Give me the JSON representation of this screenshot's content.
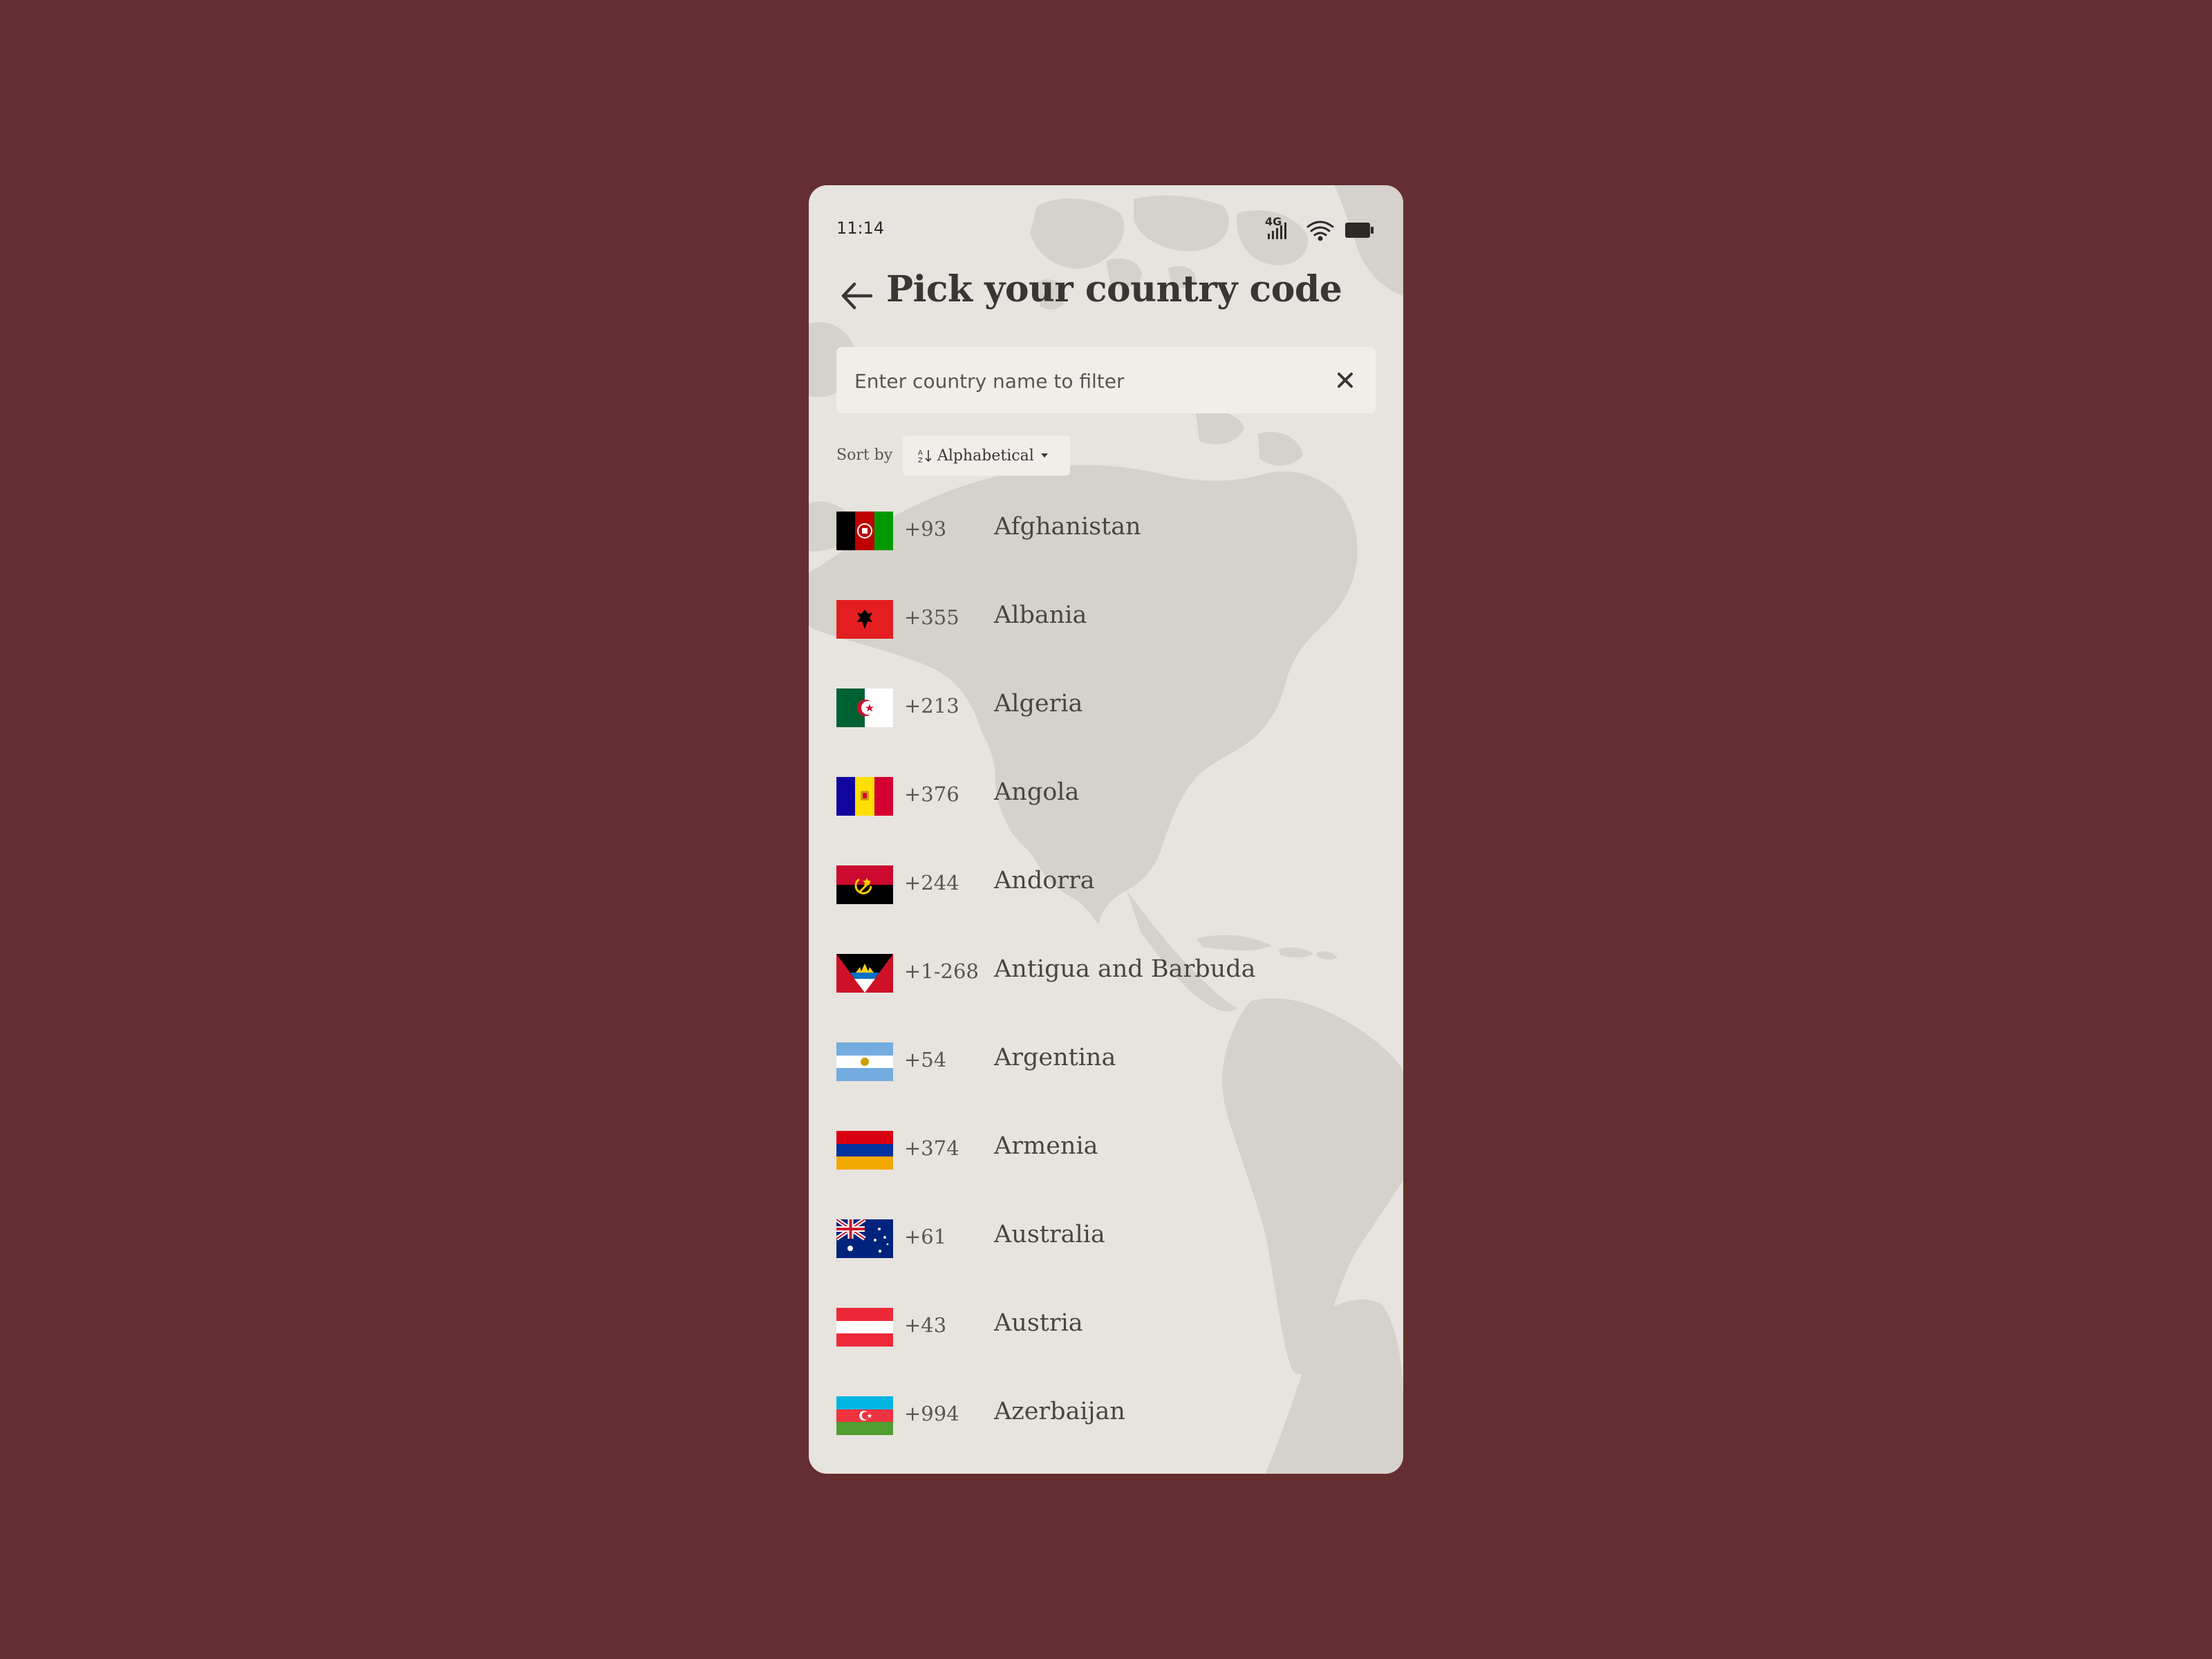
{
  "status_bar": {
    "time": "11:14",
    "network_label": "4G",
    "icons": [
      "signal-icon",
      "wifi-icon",
      "battery-icon"
    ]
  },
  "header": {
    "title": "Pick your country code",
    "back_icon": "arrow-left-icon"
  },
  "search": {
    "placeholder": "Enter country name to filter",
    "value": "",
    "clear_icon": "close-icon"
  },
  "sort": {
    "label": "Sort by",
    "selected": "Alphabetical",
    "icon": "sort-az-icon",
    "caret_icon": "caret-down-icon"
  },
  "countries": [
    {
      "code": "+93",
      "name": "Afghanistan",
      "flag": "afghanistan-flag-icon"
    },
    {
      "code": "+355",
      "name": "Albania",
      "flag": "albania-flag-icon"
    },
    {
      "code": "+213",
      "name": "Algeria",
      "flag": "algeria-flag-icon"
    },
    {
      "code": "+376",
      "name": "Angola",
      "flag": "andorra-flag-icon"
    },
    {
      "code": "+244",
      "name": "Andorra",
      "flag": "angola-flag-icon"
    },
    {
      "code": "+1-268",
      "name": "Antigua and Barbuda",
      "flag": "antigua-flag-icon"
    },
    {
      "code": "+54",
      "name": "Argentina",
      "flag": "argentina-flag-icon"
    },
    {
      "code": "+374",
      "name": "Armenia",
      "flag": "armenia-flag-icon"
    },
    {
      "code": "+61",
      "name": "Australia",
      "flag": "australia-flag-icon"
    },
    {
      "code": "+43",
      "name": "Austria",
      "flag": "austria-flag-icon"
    },
    {
      "code": "+994",
      "name": "Azerbaijan",
      "flag": "azerbaijan-flag-icon"
    }
  ],
  "colors": {
    "page_background": "#652e30",
    "screen_background": "#e7e3de",
    "map_land": "#d5d1cb",
    "input_background": "#f1eeea",
    "title_text": "#3a3633"
  }
}
